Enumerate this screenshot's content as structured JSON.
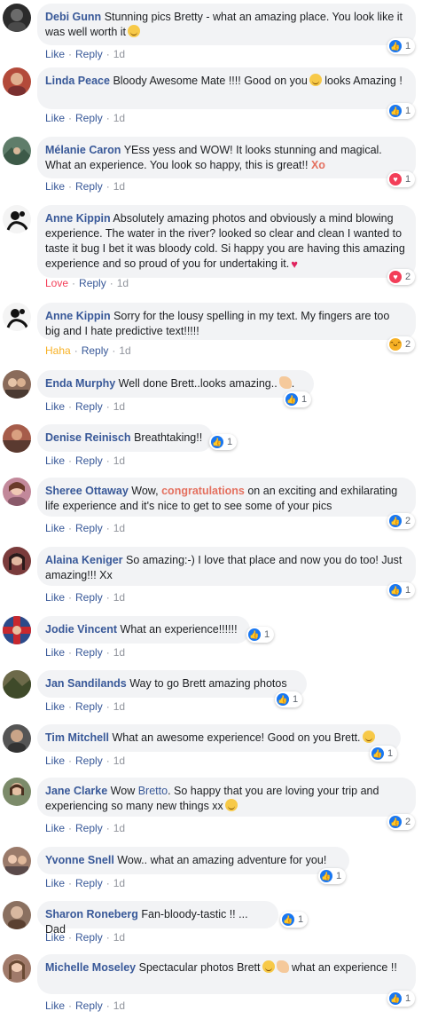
{
  "comments": [
    {
      "author": "Debi Gunn",
      "text": "Stunning pics Bretty - what an amazing place. You look like it was well worth it",
      "emoji": "smile",
      "action": "Like",
      "reply": "Reply",
      "time": "1d",
      "reaction": "like",
      "count": "1",
      "avatar_color": "#2b2b2b"
    },
    {
      "author": "Linda Peace",
      "text": "Bloody Awesome Mate !!!! Good on you",
      "emoji_mid": "smile",
      "text2": "looks Amazing !",
      "action": "Like",
      "reply": "Reply",
      "time": "1d",
      "reaction": "like",
      "count": "1",
      "avatar_color": "#b34a3a"
    },
    {
      "author": "Mélanie Caron",
      "text": "YEss yess and WOW! It looks stunning and magical. What an experience. You look so happy, this is great!!",
      "highlight": "Xo",
      "action": "Like",
      "reply": "Reply",
      "time": "1d",
      "reaction": "love",
      "count": "1",
      "avatar_color": "#5f7d6a"
    },
    {
      "author": "Anne Kippin",
      "text": "Absolutely amazing photos and obviously a mind blowing experience. The water in the river? looked so clear and clean I wanted to taste it bug I bet it was bloody cold. Si happy you are having this amazing experience and so proud of you for undertaking it.",
      "emoji": "heart",
      "action": "Love",
      "reply": "Reply",
      "time": "1d",
      "reaction": "love",
      "count": "2",
      "avatar_color": "#dddddd"
    },
    {
      "author": "Anne Kippin",
      "text": "Sorry for the lousy spelling in my text. My fingers are too big and I hate predictive text!!!!!",
      "action": "Haha",
      "reply": "Reply",
      "time": "1d",
      "reaction": "haha",
      "count": "2",
      "avatar_color": "#dddddd"
    },
    {
      "author": "Enda Murphy",
      "text": "Well done Brett..looks amazing..",
      "emoji": "hand",
      "text2": ".",
      "action": "Like",
      "reply": "Reply",
      "time": "1d",
      "reaction": "like",
      "count": "1",
      "avatar_color": "#8a6b5a"
    },
    {
      "author": "Denise Reinisch",
      "text": "Breathtaking!!",
      "action": "Like",
      "reply": "Reply",
      "time": "1d",
      "reaction": "like",
      "count": "1",
      "avatar_color": "#a65c4a"
    },
    {
      "author": "Sheree Ottaway",
      "text": "Wow,",
      "highlight": "congratulations",
      "text2": "on an exciting and exhilarating life experience and it's nice to get to see some of your pics",
      "action": "Like",
      "reply": "Reply",
      "time": "1d",
      "reaction": "like",
      "count": "2",
      "avatar_color": "#c2889a"
    },
    {
      "author": "Alaina Keniger",
      "text": "So amazing:-) I love that place and now you do too! Just amazing!!! Xx",
      "action": "Like",
      "reply": "Reply",
      "time": "1d",
      "reaction": "like",
      "count": "1",
      "avatar_color": "#7a3b3b"
    },
    {
      "author": "Jodie Vincent",
      "text": "What an experience!!!!!!",
      "action": "Like",
      "reply": "Reply",
      "time": "1d",
      "reaction": "like",
      "count": "1",
      "avatar_color": "#2c4a8a"
    },
    {
      "author": "Jan Sandilands",
      "text": "Way to go Brett amazing photos",
      "action": "Like",
      "reply": "Reply",
      "time": "1d",
      "reaction": "like",
      "count": "1",
      "avatar_color": "#6d6a4a"
    },
    {
      "author": "Tim Mitchell",
      "text": "What an awesome experience! Good on you Brett.",
      "emoji": "smile",
      "action": "Like",
      "reply": "Reply",
      "time": "1d",
      "reaction": "like",
      "count": "1",
      "avatar_color": "#555555"
    },
    {
      "author": "Jane Clarke",
      "text": "Wow",
      "mention": "Bretto",
      "text2": ". So happy that you are loving your trip and experiencing so many new things xx",
      "emoji": "smile",
      "action": "Like",
      "reply": "Reply",
      "time": "1d",
      "reaction": "like",
      "count": "2",
      "avatar_color": "#7c8b6a"
    },
    {
      "author": "Yvonne Snell",
      "text": "Wow.. what an amazing adventure for you!",
      "action": "Like",
      "reply": "Reply",
      "time": "1d",
      "reaction": "like",
      "count": "1",
      "avatar_color": "#9a7a6a"
    },
    {
      "author": "Sharon Roneberg",
      "text": "Fan-bloody-tastic !! ... Dad",
      "action": "Like",
      "reply": "Reply",
      "time": "1d",
      "reaction": "like",
      "count": "1",
      "avatar_color": "#8a7060"
    },
    {
      "author": "Michelle Moseley",
      "text": "Spectacular photos Brett",
      "emoji": "smile",
      "emoji2": "hand",
      "text2": "what an experience !!",
      "action": "Like",
      "reply": "Reply",
      "time": "1d",
      "reaction": "like",
      "count": "1",
      "avatar_color": "#a07a6a"
    }
  ],
  "icons": {
    "like": "thumbs-up-icon",
    "love": "heart-icon",
    "haha": "laugh-icon"
  },
  "colors": {
    "link": "#385898",
    "bubble": "#f2f3f5",
    "meta": "#90949c",
    "like": "#1877f2",
    "love": "#f33e58",
    "haha": "#f7b125",
    "highlight": "#e4705f"
  }
}
